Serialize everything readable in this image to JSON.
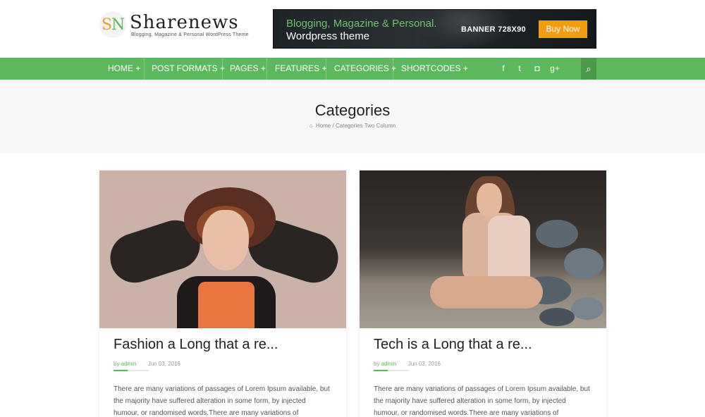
{
  "logo": {
    "mark_s": "S",
    "mark_n": "N",
    "title": "Sharenews",
    "tagline": "Blogging, Magazine & Personal WordPress Theme"
  },
  "banner": {
    "line1": "Blogging, Magazine & Personal.",
    "line2": "Wordpress theme",
    "size_label": "BANNER 728X90",
    "cta": "Buy Now"
  },
  "nav": {
    "items": [
      {
        "label": "HOME",
        "plus": "+"
      },
      {
        "label": "POST FORMATS",
        "plus": "+"
      },
      {
        "label": "PAGES",
        "plus": "+"
      },
      {
        "label": "FEATURES",
        "plus": "+"
      },
      {
        "label": "CATEGORIES",
        "plus": "+"
      },
      {
        "label": "SHORTCODES",
        "plus": "+"
      }
    ],
    "social": [
      {
        "icon": "facebook-icon",
        "glyph": "f"
      },
      {
        "icon": "twitter-icon",
        "glyph": "t"
      },
      {
        "icon": "instagram-icon",
        "glyph": "◘"
      },
      {
        "icon": "google-plus-icon",
        "glyph": "g+"
      }
    ],
    "search_icon": "⌕"
  },
  "page": {
    "title": "Categories",
    "breadcrumb_home": "Home",
    "breadcrumb_sep": "/",
    "breadcrumb_current": "Categories Two Column"
  },
  "posts": [
    {
      "title": "Fashion a Long that a re...",
      "author_prefix": "by",
      "author": "admin",
      "date": "Jun 03, 2016",
      "excerpt": "There are many variations of passages of Lorem Ipsum available, but the majority have suffered alteration in some form, by injected humour, or randomised words.There are many variations of"
    },
    {
      "title": "Tech is a Long that a re...",
      "author_prefix": "by",
      "author": "admin",
      "date": "Jun 03, 2016",
      "excerpt": "There are many variations of passages of Lorem Ipsum available, but the majority have suffered alteration in some form, by injected humour, or randomised words.There are many variations of"
    }
  ],
  "colors": {
    "accent": "#5cb85c",
    "cta": "#f39c12"
  }
}
